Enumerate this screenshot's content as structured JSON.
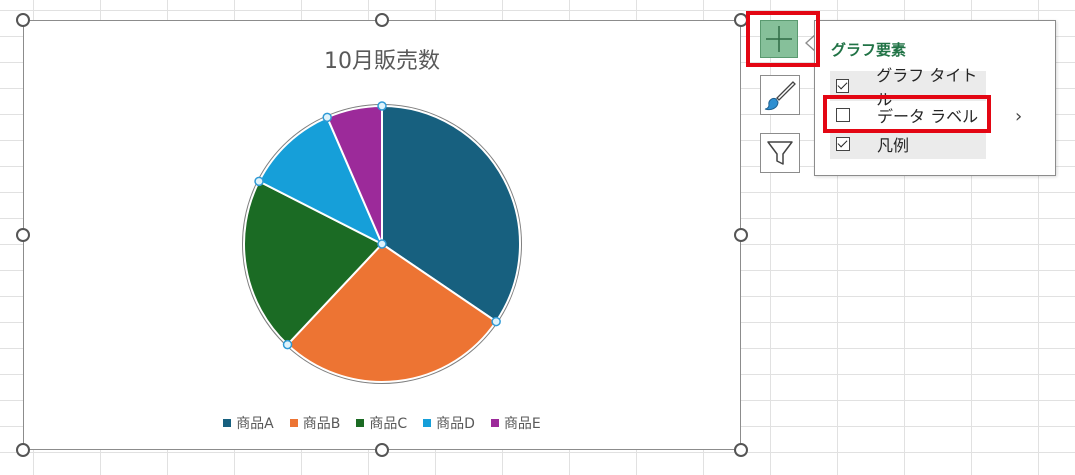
{
  "chart_data": {
    "type": "pie",
    "title": "10月販売数",
    "categories": [
      "商品A",
      "商品B",
      "商品C",
      "商品D",
      "商品E"
    ],
    "values": [
      34.5,
      27.5,
      20.5,
      11,
      6.5
    ],
    "colors": [
      "#17607f",
      "#ed7433",
      "#1b6b24",
      "#169fd9",
      "#9c2a9a"
    ],
    "legend_position": "bottom"
  },
  "side_buttons": {
    "plus": "chart-elements",
    "brush": "chart-styles",
    "filter": "chart-filters"
  },
  "popup": {
    "title": "グラフ要素",
    "items": [
      {
        "label": "グラフ タイトル",
        "checked": true
      },
      {
        "label": "データ ラベル",
        "checked": false
      },
      {
        "label": "凡例",
        "checked": true
      }
    ],
    "submenu_glyph": "›"
  }
}
